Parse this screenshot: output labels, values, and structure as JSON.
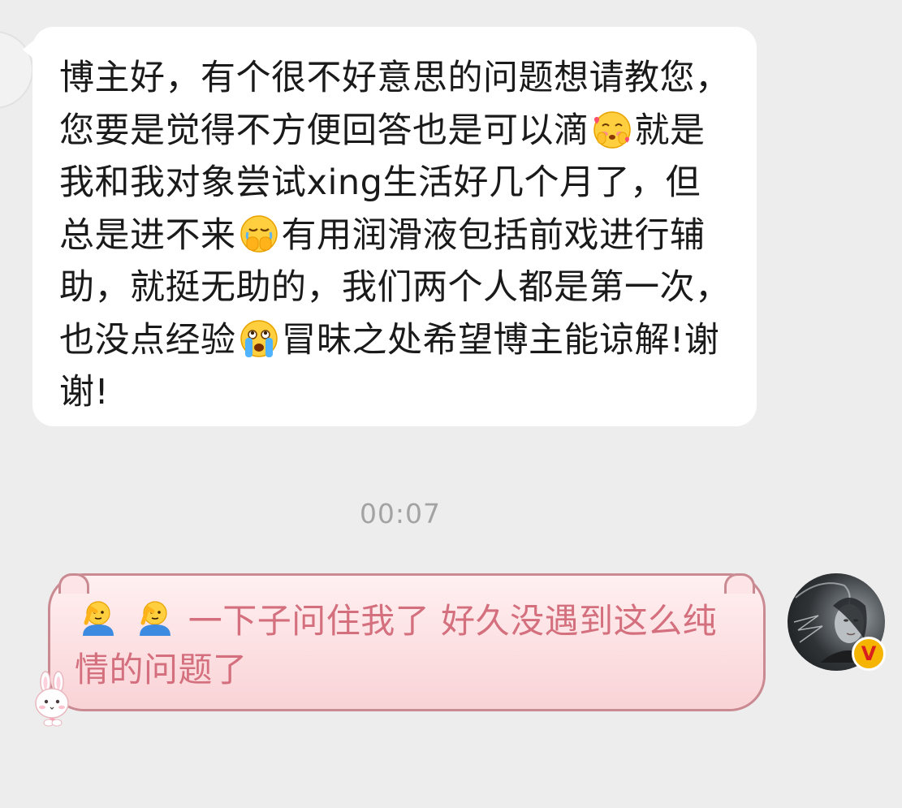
{
  "conversation": {
    "incoming": {
      "segments": [
        "博主好，有个很不好意思的问题想请教您，您要是觉得不方便回答也是可以滴",
        "就是我和我对象尝试xing生活好几个月了，但总是进不来",
        "有用润滑液包括前戏进行辅助，就挺无助的，我们两个人都是第一次，也没点经验",
        "冒昧之处希望博主能谅解!谢谢!"
      ],
      "emoji_names": [
        "shy-blush-emoji",
        "hands-over-face-emoji",
        "crying-emoji"
      ]
    },
    "timestamp": "00:07",
    "outgoing": {
      "text": "一下子问住我了 好久没遇到这么纯情的问题了",
      "emoji_names": [
        "salute-emoji",
        "salute-emoji"
      ],
      "bubble_theme": "pink-bunny",
      "verified_badge": "V"
    }
  },
  "colors": {
    "background": "#ededed",
    "incoming_bubble": "#ffffff",
    "incoming_text": "#1a1a1a",
    "outgoing_bubble": "#fde4e6",
    "outgoing_border": "#c98a92",
    "outgoing_text": "#d46f7e",
    "timestamp": "#a3a3a3",
    "badge": "#f5b400"
  }
}
